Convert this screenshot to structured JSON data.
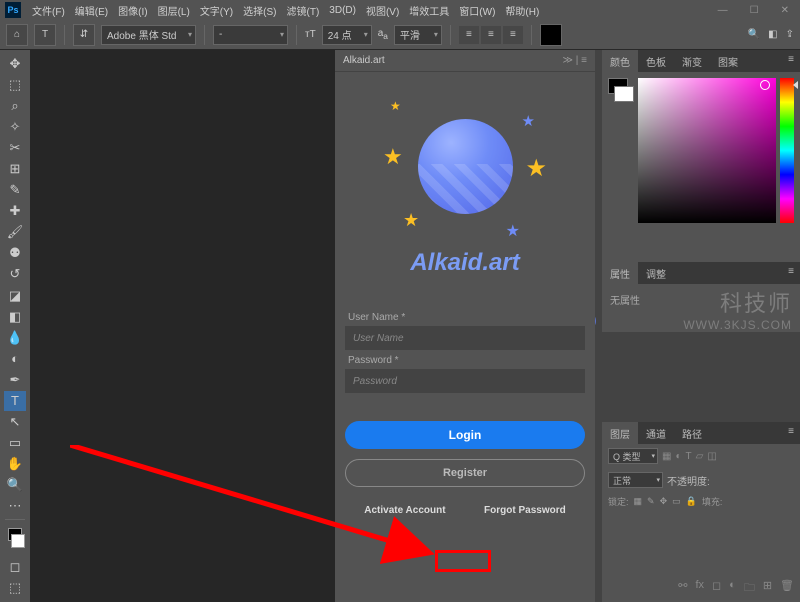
{
  "menubar": {
    "items": [
      "文件(F)",
      "编辑(E)",
      "图像(I)",
      "图层(L)",
      "文字(Y)",
      "选择(S)",
      "滤镜(T)",
      "3D(D)",
      "视图(V)",
      "增效工具",
      "窗口(W)",
      "帮助(H)"
    ]
  },
  "options": {
    "font_family": "Adobe 黑体 Std",
    "font_style": "-",
    "font_size": "24 点",
    "aa": "平滑"
  },
  "ext": {
    "title": "Alkaid.art",
    "brand": "Alkaid.art",
    "user_label": "User Name *",
    "user_ph": "User Name",
    "pass_label": "Password *",
    "pass_ph": "Password",
    "login": "Login",
    "register": "Register",
    "activate": "Activate Account",
    "forgot": "Forgot Password"
  },
  "panels": {
    "color_tabs": [
      "颜色",
      "色板",
      "渐变",
      "图案"
    ],
    "props_tabs": [
      "属性",
      "调整"
    ],
    "props_text": "无属性",
    "layers_tabs": [
      "图层",
      "通道",
      "路径"
    ],
    "layer_kind": "Q 类型",
    "blend_mode": "正常",
    "opacity_label": "不透明度:",
    "lock_label": "锁定:",
    "fill_label": "填充:"
  },
  "watermark": {
    "line1": "科技师",
    "line2": "WWW.3KJS.COM"
  }
}
